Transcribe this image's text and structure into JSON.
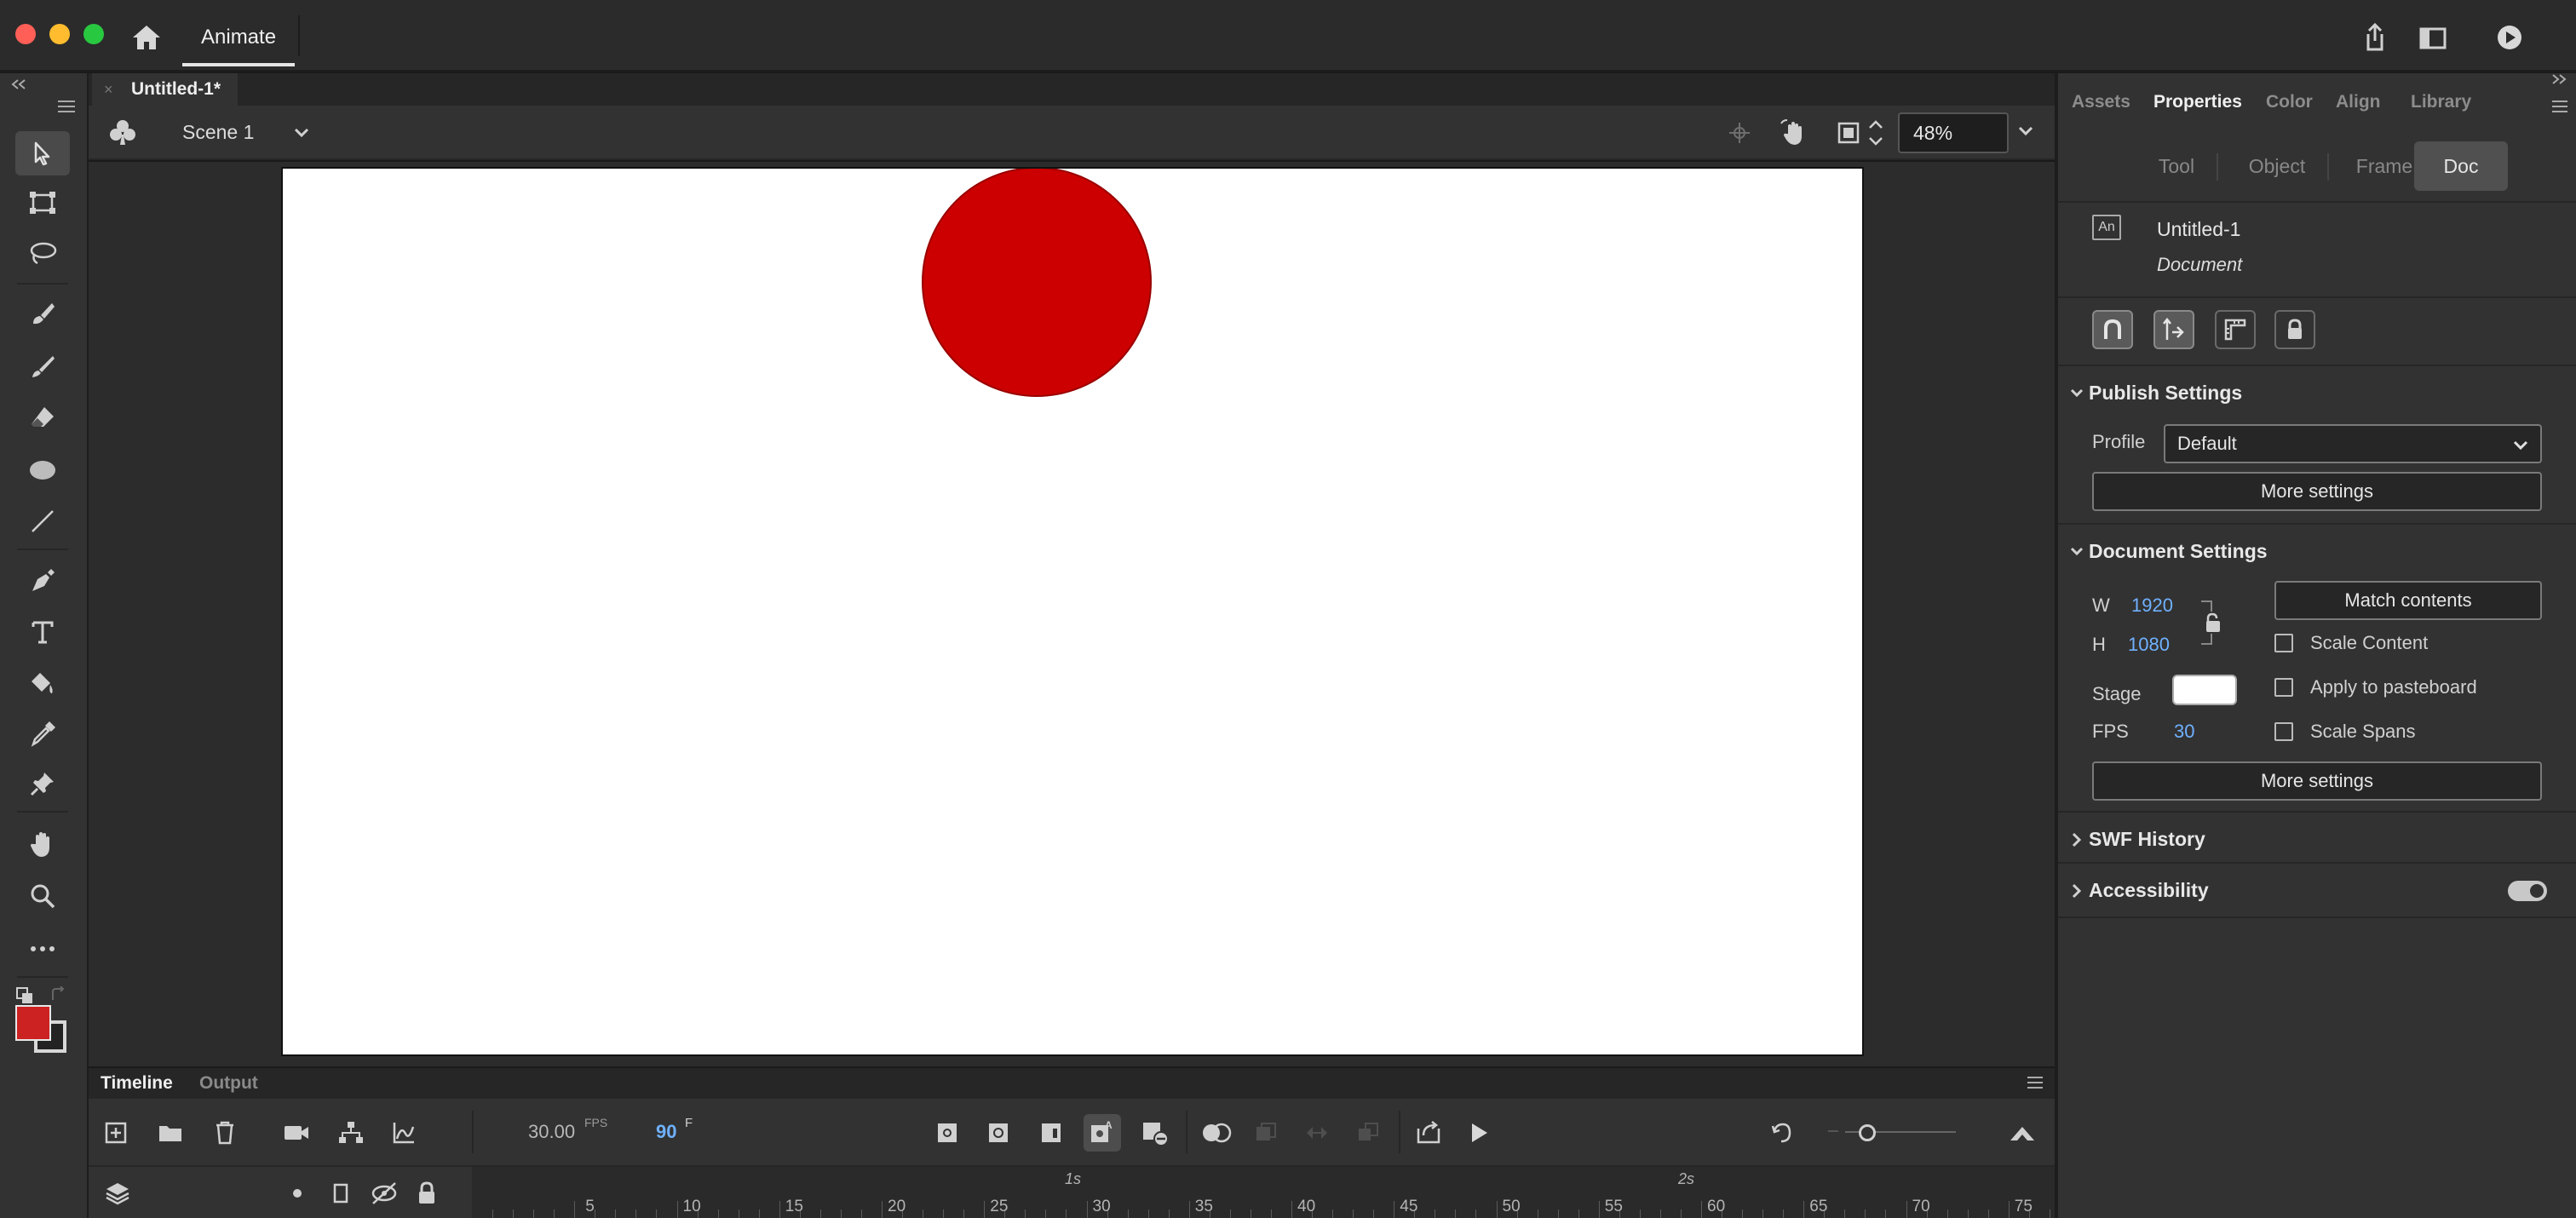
{
  "app": {
    "title": "Animate"
  },
  "document": {
    "tab_label": "Untitled-1*",
    "scene": "Scene 1",
    "zoom": "48%"
  },
  "stage": {
    "background_color": "#ffffff",
    "circle_color": "#cc0000"
  },
  "timeline": {
    "tabs": [
      "Timeline",
      "Output"
    ],
    "fps_value": "30.00",
    "fps_label": "FPS",
    "frame_value": "90",
    "frame_label": "F",
    "ruler_numbers": [
      "5",
      "10",
      "15",
      "20",
      "25",
      "30",
      "35",
      "40",
      "45",
      "50",
      "55",
      "60",
      "65",
      "70",
      "75"
    ],
    "ruler_seconds": [
      "1s",
      "2s"
    ]
  },
  "properties": {
    "panel_tabs": [
      "Assets",
      "Properties",
      "Color",
      "Align",
      "Library"
    ],
    "active_panel_tab": "Properties",
    "sub_tabs": [
      "Tool",
      "Object",
      "Frame",
      "Doc"
    ],
    "active_sub_tab": "Doc",
    "an_icon_text": "An",
    "doc_name": "Untitled-1",
    "doc_type": "Document",
    "publish": {
      "heading": "Publish Settings",
      "profile_label": "Profile",
      "profile_value": "Default",
      "more_settings": "More settings"
    },
    "doc_settings": {
      "heading": "Document Settings",
      "w_label": "W",
      "w_value": "1920",
      "h_label": "H",
      "h_value": "1080",
      "match_contents": "Match contents",
      "scale_content": "Scale Content",
      "apply_pasteboard": "Apply to pasteboard",
      "scale_spans": "Scale Spans",
      "stage_label": "Stage",
      "fps_label": "FPS",
      "fps_value": "30",
      "more_settings": "More settings"
    },
    "swf_history": "SWF History",
    "accessibility": "Accessibility"
  },
  "colors": {
    "fill_swatch": "#cc2222",
    "accent_value": "#6fb1ff"
  }
}
